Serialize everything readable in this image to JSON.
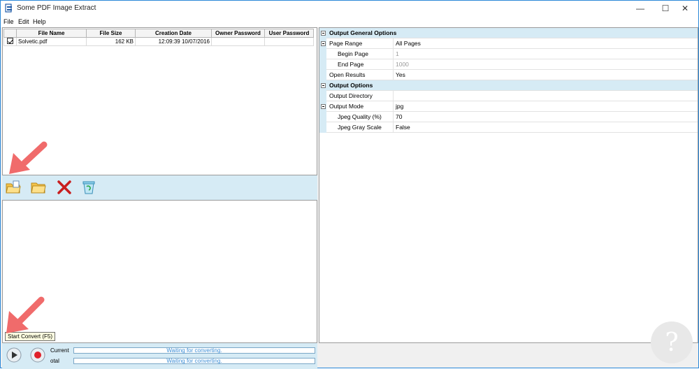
{
  "window": {
    "title": "Some PDF Image Extract",
    "minimize": "—",
    "maximize": "☐",
    "close": "✕"
  },
  "menu": {
    "file": "File",
    "edit": "Edit",
    "help": "Help"
  },
  "file_table": {
    "headers": [
      "File Name",
      "File Size",
      "Creation Date",
      "Owner Password",
      "User Password"
    ],
    "rows": [
      {
        "checked": true,
        "file_name": "Solvetic.pdf",
        "file_size": "162 KB",
        "creation_date": "12:09:39 10/07/2016",
        "owner_password": "",
        "user_password": ""
      }
    ]
  },
  "toolbar": {
    "add_file_icon": "add-file-icon",
    "open_folder_icon": "open-folder-icon",
    "remove_icon": "remove-icon",
    "clear_icon": "clear-all-icon"
  },
  "progress": {
    "current_label": "Current",
    "total_label": "otal",
    "current_status": "Waiting for converting.",
    "total_status": "Waiting for converting.",
    "tooltip": "Start Convert (F5)"
  },
  "options": {
    "general_header": "Output General Options",
    "page_range_label": "Page Range",
    "page_range_value": "All Pages",
    "begin_page_label": "Begin Page",
    "begin_page_value": "1",
    "end_page_label": "End Page",
    "end_page_value": "1000",
    "open_results_label": "Open Results",
    "open_results_value": "Yes",
    "output_header": "Output Options",
    "output_dir_label": "Output Directory",
    "output_dir_value": "",
    "output_mode_label": "Output Mode",
    "output_mode_value": "jpg",
    "jpeg_quality_label": "Jpeg Quality (%)",
    "jpeg_quality_value": "70",
    "jpeg_gray_label": "Jpeg Gray Scale",
    "jpeg_gray_value": "False"
  },
  "colors": {
    "accent_panel": "#d6ebf5",
    "annotation_arrow": "#f06b6b"
  }
}
